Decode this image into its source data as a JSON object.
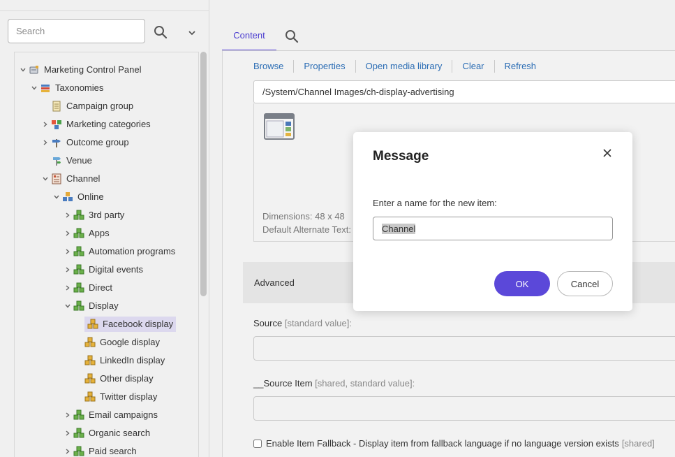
{
  "sidebar": {
    "search": {
      "placeholder": "Search",
      "value": ""
    },
    "search_icon": "search-icon",
    "toggle_icon": "chevron-down-icon",
    "tree": [
      {
        "label": "Marketing Control Panel",
        "icon": "marketing-panel-icon",
        "expanded": true
      },
      {
        "label": "Taxonomies",
        "icon": "books-icon",
        "expanded": true
      },
      {
        "label": "Campaign group",
        "icon": "document-list-icon"
      },
      {
        "label": "Marketing categories",
        "icon": "category-blocks-icon",
        "expanded": false
      },
      {
        "label": "Outcome group",
        "icon": "signpost-icon",
        "expanded": false
      },
      {
        "label": "Venue",
        "icon": "venue-icon"
      },
      {
        "label": "Channel",
        "icon": "channel-doc-icon",
        "expanded": true
      },
      {
        "label": "Online",
        "icon": "online-cubes-icon",
        "expanded": true
      },
      {
        "label": "3rd party",
        "icon": "green-cubes-icon",
        "expanded": false
      },
      {
        "label": "Apps",
        "icon": "green-cubes-icon",
        "expanded": false
      },
      {
        "label": "Automation programs",
        "icon": "green-cubes-icon",
        "expanded": false
      },
      {
        "label": "Digital events",
        "icon": "green-cubes-icon",
        "expanded": false
      },
      {
        "label": "Direct",
        "icon": "green-cubes-icon",
        "expanded": false
      },
      {
        "label": "Display",
        "icon": "green-cubes-icon",
        "expanded": true
      },
      {
        "label": "Facebook display",
        "icon": "gold-cubes-icon",
        "selected": true
      },
      {
        "label": "Google display",
        "icon": "gold-cubes-icon"
      },
      {
        "label": "LinkedIn display",
        "icon": "gold-cubes-icon"
      },
      {
        "label": "Other display",
        "icon": "gold-cubes-icon"
      },
      {
        "label": "Twitter display",
        "icon": "gold-cubes-icon"
      },
      {
        "label": "Email campaigns",
        "icon": "green-cubes-icon",
        "expanded": false
      },
      {
        "label": "Organic search",
        "icon": "green-cubes-icon",
        "expanded": false
      },
      {
        "label": "Paid search",
        "icon": "green-cubes-icon",
        "expanded": false
      }
    ]
  },
  "main": {
    "tabs": [
      {
        "label": "Content",
        "active": true
      }
    ],
    "tab_search_icon": "search-icon",
    "image_field": {
      "toolbar": [
        "Browse",
        "Properties",
        "Open media library",
        "Clear",
        "Refresh"
      ],
      "path": "/System/Channel Images/ch-display-advertising",
      "dimensions": "Dimensions: 48 x 48",
      "alt_text": "Default Alternate Text: V"
    },
    "section": {
      "label": "Advanced"
    },
    "source": {
      "label": "Source",
      "hint": "[standard value]:",
      "value": ""
    },
    "source_item": {
      "label": "__Source Item",
      "hint": "[shared, standard value]:",
      "value": ""
    },
    "fallback": {
      "label": "Enable Item Fallback - Display item from fallback language if no language version exists",
      "hint": "[shared]",
      "checked": false
    }
  },
  "dialog": {
    "title": "Message",
    "prompt": "Enter a name for the new item:",
    "value": "Channel",
    "ok_label": "OK",
    "cancel_label": "Cancel",
    "accent_color": "#5b48d9"
  }
}
